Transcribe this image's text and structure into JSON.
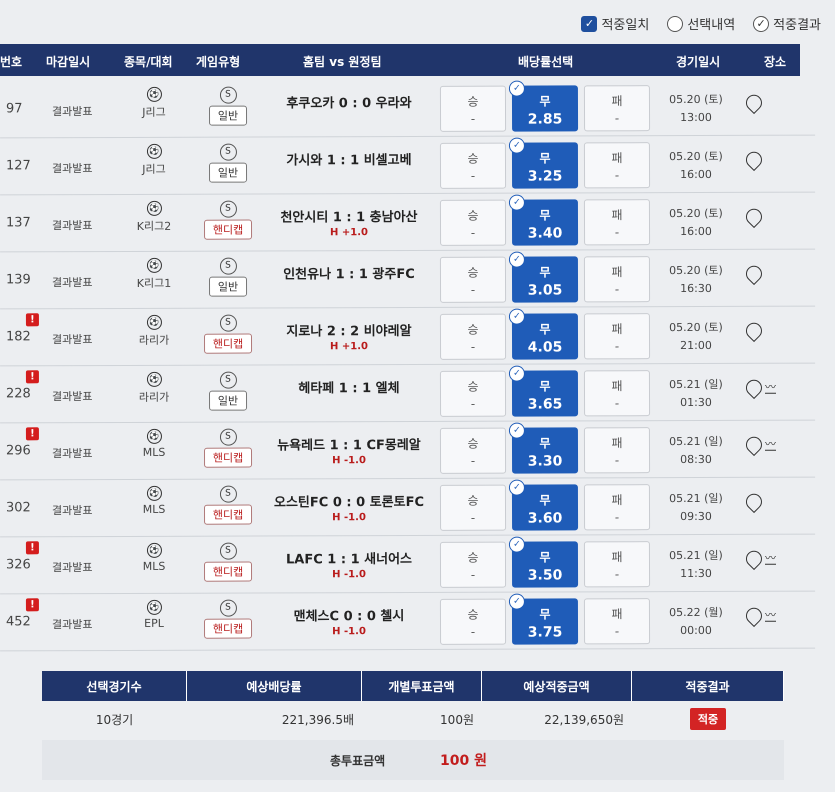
{
  "filters": [
    {
      "label": "적중일치",
      "checked": true
    },
    {
      "label": "선택내역",
      "checked": false
    },
    {
      "label": "적중결과",
      "checked": true
    }
  ],
  "columns": [
    "번호",
    "마감일시",
    "종목/대회",
    "게임유형",
    "홈팀 vs 원정팀",
    "배당률선택",
    "경기일시",
    "장소"
  ],
  "rows": [
    {
      "no": "97",
      "warn": false,
      "deadline": "결과발표",
      "league": "J리그",
      "type": "일반",
      "match": "후쿠오카 0 : 0 우라와",
      "handicap": "",
      "win": "승",
      "win_odds": "-",
      "draw": "무",
      "draw_odds": "2.85",
      "lose": "패",
      "lose_odds": "-",
      "date": "05.20 (토)",
      "time": "13:00",
      "stats": false
    },
    {
      "no": "127",
      "warn": false,
      "deadline": "결과발표",
      "league": "J리그",
      "type": "일반",
      "match": "가시와 1 : 1 비셀고베",
      "handicap": "",
      "win": "승",
      "win_odds": "-",
      "draw": "무",
      "draw_odds": "3.25",
      "lose": "패",
      "lose_odds": "-",
      "date": "05.20 (토)",
      "time": "16:00",
      "stats": false
    },
    {
      "no": "137",
      "warn": false,
      "deadline": "결과발표",
      "league": "K리그2",
      "type": "핸디캡",
      "match": "천안시티 1 : 1 충남아산",
      "handicap": "H +1.0",
      "win": "승",
      "win_odds": "-",
      "draw": "무",
      "draw_odds": "3.40",
      "lose": "패",
      "lose_odds": "-",
      "date": "05.20 (토)",
      "time": "16:00",
      "stats": false
    },
    {
      "no": "139",
      "warn": false,
      "deadline": "결과발표",
      "league": "K리그1",
      "type": "일반",
      "match": "인천유나 1 : 1 광주FC",
      "handicap": "",
      "win": "승",
      "win_odds": "-",
      "draw": "무",
      "draw_odds": "3.05",
      "lose": "패",
      "lose_odds": "-",
      "date": "05.20 (토)",
      "time": "16:30",
      "stats": false
    },
    {
      "no": "182",
      "warn": true,
      "deadline": "결과발표",
      "league": "라리가",
      "type": "핸디캡",
      "match": "지로나 2 : 2 비야레알",
      "handicap": "H +1.0",
      "win": "승",
      "win_odds": "-",
      "draw": "무",
      "draw_odds": "4.05",
      "lose": "패",
      "lose_odds": "-",
      "date": "05.20 (토)",
      "time": "21:00",
      "stats": false
    },
    {
      "no": "228",
      "warn": true,
      "deadline": "결과발표",
      "league": "라리가",
      "type": "일반",
      "match": "헤타페 1 : 1 엘체",
      "handicap": "",
      "win": "승",
      "win_odds": "-",
      "draw": "무",
      "draw_odds": "3.65",
      "lose": "패",
      "lose_odds": "-",
      "date": "05.21 (일)",
      "time": "01:30",
      "stats": true
    },
    {
      "no": "296",
      "warn": true,
      "deadline": "결과발표",
      "league": "MLS",
      "type": "핸디캡",
      "match": "뉴욕레드 1 : 1 CF몽레알",
      "handicap": "H -1.0",
      "win": "승",
      "win_odds": "-",
      "draw": "무",
      "draw_odds": "3.30",
      "lose": "패",
      "lose_odds": "-",
      "date": "05.21 (일)",
      "time": "08:30",
      "stats": true
    },
    {
      "no": "302",
      "warn": false,
      "deadline": "결과발표",
      "league": "MLS",
      "type": "핸디캡",
      "match": "오스틴FC 0 : 0 토론토FC",
      "handicap": "H -1.0",
      "win": "승",
      "win_odds": "-",
      "draw": "무",
      "draw_odds": "3.60",
      "lose": "패",
      "lose_odds": "-",
      "date": "05.21 (일)",
      "time": "09:30",
      "stats": false
    },
    {
      "no": "326",
      "warn": true,
      "deadline": "결과발표",
      "league": "MLS",
      "type": "핸디캡",
      "match": "LAFC 1 : 1 새너어스",
      "handicap": "H -1.0",
      "win": "승",
      "win_odds": "-",
      "draw": "무",
      "draw_odds": "3.50",
      "lose": "패",
      "lose_odds": "-",
      "date": "05.21 (일)",
      "time": "11:30",
      "stats": true
    },
    {
      "no": "452",
      "warn": true,
      "deadline": "결과발표",
      "league": "EPL",
      "type": "핸디캡",
      "match": "맨체스C 0 : 0 첼시",
      "handicap": "H -1.0",
      "win": "승",
      "win_odds": "-",
      "draw": "무",
      "draw_odds": "3.75",
      "lose": "패",
      "lose_odds": "-",
      "date": "05.22 (월)",
      "time": "00:00",
      "stats": true
    }
  ],
  "summary": {
    "headers": [
      "선택경기수",
      "예상배당률",
      "개별투표금액",
      "예상적중금액",
      "적중결과"
    ],
    "games": "10경기",
    "odds": "221,396.5배",
    "bet": "100원",
    "payout": "22,139,650원",
    "result": "적중"
  },
  "total": {
    "label": "총투표금액",
    "value": "100 원"
  },
  "icons": {
    "sport": "soccer-ball-icon",
    "special": "s-badge-icon",
    "location": "map-pin-icon",
    "stats": "trend-chart-icon",
    "warning": "alert-icon"
  }
}
